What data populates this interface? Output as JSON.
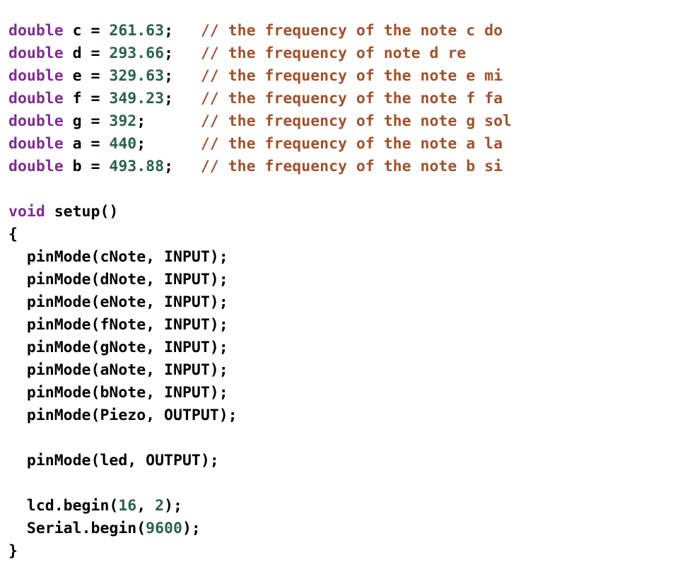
{
  "editor": {
    "language": "arduino-cpp",
    "background_color": "#ffffff",
    "default_text_color": "#000000",
    "keyword_color": "#7D2E8E",
    "number_color": "#2A6349",
    "comment_color": "#A0522D"
  },
  "code": {
    "lines": [
      {
        "index": 1,
        "text": "double c = 261.63;   // the frequency of the note c do",
        "tokens": [
          {
            "t": "double",
            "k": "kw"
          },
          {
            "t": " c = ",
            "k": "plain"
          },
          {
            "t": "261.63",
            "k": "num"
          },
          {
            "t": ";   ",
            "k": "plain"
          },
          {
            "t": "// the frequency of the note c do",
            "k": "com"
          }
        ]
      },
      {
        "index": 2,
        "text": "double d = 293.66;   // the frequency of note d re",
        "tokens": [
          {
            "t": "double",
            "k": "kw"
          },
          {
            "t": " d = ",
            "k": "plain"
          },
          {
            "t": "293.66",
            "k": "num"
          },
          {
            "t": ";   ",
            "k": "plain"
          },
          {
            "t": "// the frequency of note d re",
            "k": "com"
          }
        ]
      },
      {
        "index": 3,
        "text": "double e = 329.63;   // the frequency of the note e mi",
        "tokens": [
          {
            "t": "double",
            "k": "kw"
          },
          {
            "t": " e = ",
            "k": "plain"
          },
          {
            "t": "329.63",
            "k": "num"
          },
          {
            "t": ";   ",
            "k": "plain"
          },
          {
            "t": "// the frequency of the note e mi",
            "k": "com"
          }
        ]
      },
      {
        "index": 4,
        "text": "double f = 349.23;   // the frequency of the note f fa",
        "tokens": [
          {
            "t": "double",
            "k": "kw"
          },
          {
            "t": " f = ",
            "k": "plain"
          },
          {
            "t": "349.23",
            "k": "num"
          },
          {
            "t": ";   ",
            "k": "plain"
          },
          {
            "t": "// the frequency of the note f fa",
            "k": "com"
          }
        ]
      },
      {
        "index": 5,
        "text": "double g = 392;      // the frequency of the note g sol",
        "tokens": [
          {
            "t": "double",
            "k": "kw"
          },
          {
            "t": " g = ",
            "k": "plain"
          },
          {
            "t": "392",
            "k": "num"
          },
          {
            "t": ";      ",
            "k": "plain"
          },
          {
            "t": "// the frequency of the note g sol",
            "k": "com"
          }
        ]
      },
      {
        "index": 6,
        "text": "double a = 440;      // the frequency of the note a la",
        "tokens": [
          {
            "t": "double",
            "k": "kw"
          },
          {
            "t": " a = ",
            "k": "plain"
          },
          {
            "t": "440",
            "k": "num"
          },
          {
            "t": ";      ",
            "k": "plain"
          },
          {
            "t": "// the frequency of the note a la",
            "k": "com"
          }
        ]
      },
      {
        "index": 7,
        "text": "double b = 493.88;   // the frequency of the note b si",
        "tokens": [
          {
            "t": "double",
            "k": "kw"
          },
          {
            "t": " b = ",
            "k": "plain"
          },
          {
            "t": "493.88",
            "k": "num"
          },
          {
            "t": ";   ",
            "k": "plain"
          },
          {
            "t": "// the frequency of the note b si",
            "k": "com"
          }
        ]
      },
      {
        "index": 8,
        "text": "",
        "tokens": []
      },
      {
        "index": 9,
        "text": "void setup()",
        "tokens": [
          {
            "t": "void",
            "k": "kw"
          },
          {
            "t": " setup()",
            "k": "plain"
          }
        ]
      },
      {
        "index": 10,
        "text": "{",
        "tokens": [
          {
            "t": "{",
            "k": "plain"
          }
        ]
      },
      {
        "index": 11,
        "text": "  pinMode(cNote, INPUT);",
        "tokens": [
          {
            "t": "  pinMode(cNote, INPUT);",
            "k": "plain"
          }
        ]
      },
      {
        "index": 12,
        "text": "  pinMode(dNote, INPUT);",
        "tokens": [
          {
            "t": "  pinMode(dNote, INPUT);",
            "k": "plain"
          }
        ]
      },
      {
        "index": 13,
        "text": "  pinMode(eNote, INPUT);",
        "tokens": [
          {
            "t": "  pinMode(eNote, INPUT);",
            "k": "plain"
          }
        ]
      },
      {
        "index": 14,
        "text": "  pinMode(fNote, INPUT);",
        "tokens": [
          {
            "t": "  pinMode(fNote, INPUT);",
            "k": "plain"
          }
        ]
      },
      {
        "index": 15,
        "text": "  pinMode(gNote, INPUT);",
        "tokens": [
          {
            "t": "  pinMode(gNote, INPUT);",
            "k": "plain"
          }
        ]
      },
      {
        "index": 16,
        "text": "  pinMode(aNote, INPUT);",
        "tokens": [
          {
            "t": "  pinMode(aNote, INPUT);",
            "k": "plain"
          }
        ]
      },
      {
        "index": 17,
        "text": "  pinMode(bNote, INPUT);",
        "tokens": [
          {
            "t": "  pinMode(bNote, INPUT);",
            "k": "plain"
          }
        ]
      },
      {
        "index": 18,
        "text": "  pinMode(Piezo, OUTPUT);",
        "tokens": [
          {
            "t": "  pinMode(Piezo, OUTPUT);",
            "k": "plain"
          }
        ]
      },
      {
        "index": 19,
        "text": "",
        "tokens": []
      },
      {
        "index": 20,
        "text": "  pinMode(led, OUTPUT);",
        "tokens": [
          {
            "t": "  pinMode(led, OUTPUT);",
            "k": "plain"
          }
        ]
      },
      {
        "index": 21,
        "text": "",
        "tokens": []
      },
      {
        "index": 22,
        "text": "  lcd.begin(16, 2);",
        "tokens": [
          {
            "t": "  lcd.begin(",
            "k": "plain"
          },
          {
            "t": "16",
            "k": "num"
          },
          {
            "t": ", ",
            "k": "plain"
          },
          {
            "t": "2",
            "k": "num"
          },
          {
            "t": ");",
            "k": "plain"
          }
        ]
      },
      {
        "index": 23,
        "text": "  Serial.begin(9600);",
        "tokens": [
          {
            "t": "  Serial.begin(",
            "k": "plain"
          },
          {
            "t": "9600",
            "k": "num"
          },
          {
            "t": ");",
            "k": "plain"
          }
        ]
      },
      {
        "index": 24,
        "text": "}",
        "tokens": [
          {
            "t": "}",
            "k": "plain"
          }
        ]
      }
    ]
  }
}
